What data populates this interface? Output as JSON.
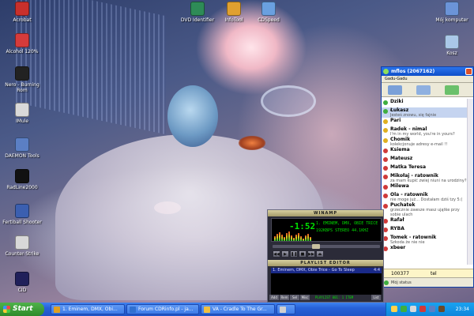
{
  "desktop_icons_left": [
    {
      "label": "Acrobat",
      "color": "#c8302c"
    },
    {
      "label": "Alcohol 120%",
      "color": "#d63b3b"
    },
    {
      "label": "Nero - Burning Rom",
      "color": "#222222"
    },
    {
      "label": "IMule",
      "color": "#d9d9d9"
    },
    {
      "label": "DAEMON Tools",
      "color": "#5b7fc4"
    },
    {
      "label": "RadLine2000",
      "color": "#111111"
    },
    {
      "label": "Fertiball Shooter",
      "color": "#3b5fb0"
    },
    {
      "label": "Counter-Strike",
      "color": "#d8d8d8"
    },
    {
      "label": "CID",
      "color": "#20205a"
    }
  ],
  "desktop_icons_top": [
    {
      "label": "DVD Identifier",
      "color": "#2e8b57"
    },
    {
      "label": "InfoTool",
      "color": "#e0a030"
    },
    {
      "label": "CDSpeed",
      "color": "#6aa0e0"
    }
  ],
  "desktop_icons_right": [
    {
      "label": "Mój komputer",
      "color": "#6b94d8"
    },
    {
      "label": "Kosz",
      "color": "#aac8e8"
    }
  ],
  "taskbar": {
    "start_label": "Start",
    "tasks": [
      {
        "label": "1. Eminem, DMX, Obi...",
        "color": "#e0a020"
      },
      {
        "label": "Forum CDRinfo.pl - ja...",
        "color": "#3070d0"
      },
      {
        "label": "VA - Cradle To The Gr...",
        "color": "#f0c040"
      },
      {
        "label": "",
        "color": "#d0d0d0"
      }
    ],
    "clock": "23:34"
  },
  "gadu_gadu": {
    "title": "mflos (2067162)",
    "menu_label": "Gadu-Gadu",
    "contacts": [
      {
        "name": "Dziki",
        "desc": "",
        "status_color": "#3fae3f"
      },
      {
        "name": "Łukasz",
        "desc": "Jesteś znowu, się fajnie",
        "status_color": "#3fae3f"
      },
      {
        "name": "Pari",
        "desc": "",
        "status_color": "#e0b020"
      },
      {
        "name": "Radek - nimal",
        "desc": "I'm in my world, you're in yours?",
        "status_color": "#e0b020"
      },
      {
        "name": "Chomik",
        "desc": "kolekcjonuje adresy e-mail !!",
        "status_color": "#e0b020"
      },
      {
        "name": "Ksiema",
        "desc": "",
        "status_color": "#d03a3a"
      },
      {
        "name": "Mateusz",
        "desc": "",
        "status_color": "#d03a3a"
      },
      {
        "name": "Matka Teresa",
        "desc": "",
        "status_color": "#d03a3a"
      },
      {
        "name": "Mikołaj - ratownik",
        "desc": "za mam kupić zwiej niuni na urodziny?",
        "status_color": "#d03a3a"
      },
      {
        "name": "Milewa",
        "desc": "",
        "status_color": "#d03a3a"
      },
      {
        "name": "Ola - ratownik",
        "desc": "nie moge już... Dostałam dziś tzy 5:(",
        "status_color": "#d03a3a"
      },
      {
        "name": "Puchatek",
        "desc": "grzecznie zawsze masz ujątke przy sobie ulach",
        "status_color": "#d03a3a"
      },
      {
        "name": "Rafał",
        "desc": "",
        "status_color": "#d03a3a"
      },
      {
        "name": "RYBA",
        "desc": "",
        "status_color": "#d03a3a"
      },
      {
        "name": "Tomek - ratownik",
        "desc": "Szkoda że nie nie",
        "status_color": "#d03a3a"
      },
      {
        "name": "xbeer",
        "desc": "",
        "status_color": "#d03a3a"
      }
    ],
    "status_number": "100377",
    "status_tel": "tel",
    "bottom_status": "Mój status"
  },
  "winamp": {
    "title": "WINAMP",
    "time": "-1:52",
    "marquee": "1. EMINEM, DMX, OBIE TRICE - GO TO",
    "kbps": "192KBPS STEREO 44.1KHZ",
    "controls": [
      "◀◀",
      "▶",
      "❚❚",
      "■",
      "▶▶",
      "⏏"
    ],
    "playlist_title": "PLAYLIST EDITOR",
    "playlist": [
      {
        "label": "1. Eminem, DMX, Obie Trice - Go To Sleep",
        "duration": "4:4"
      }
    ],
    "playlist_buttons": [
      "Add",
      "Rem",
      "Sel",
      "Misc"
    ],
    "playlist_status": "PLAYLIST 001: 1 ITEM",
    "list_button": "List"
  }
}
